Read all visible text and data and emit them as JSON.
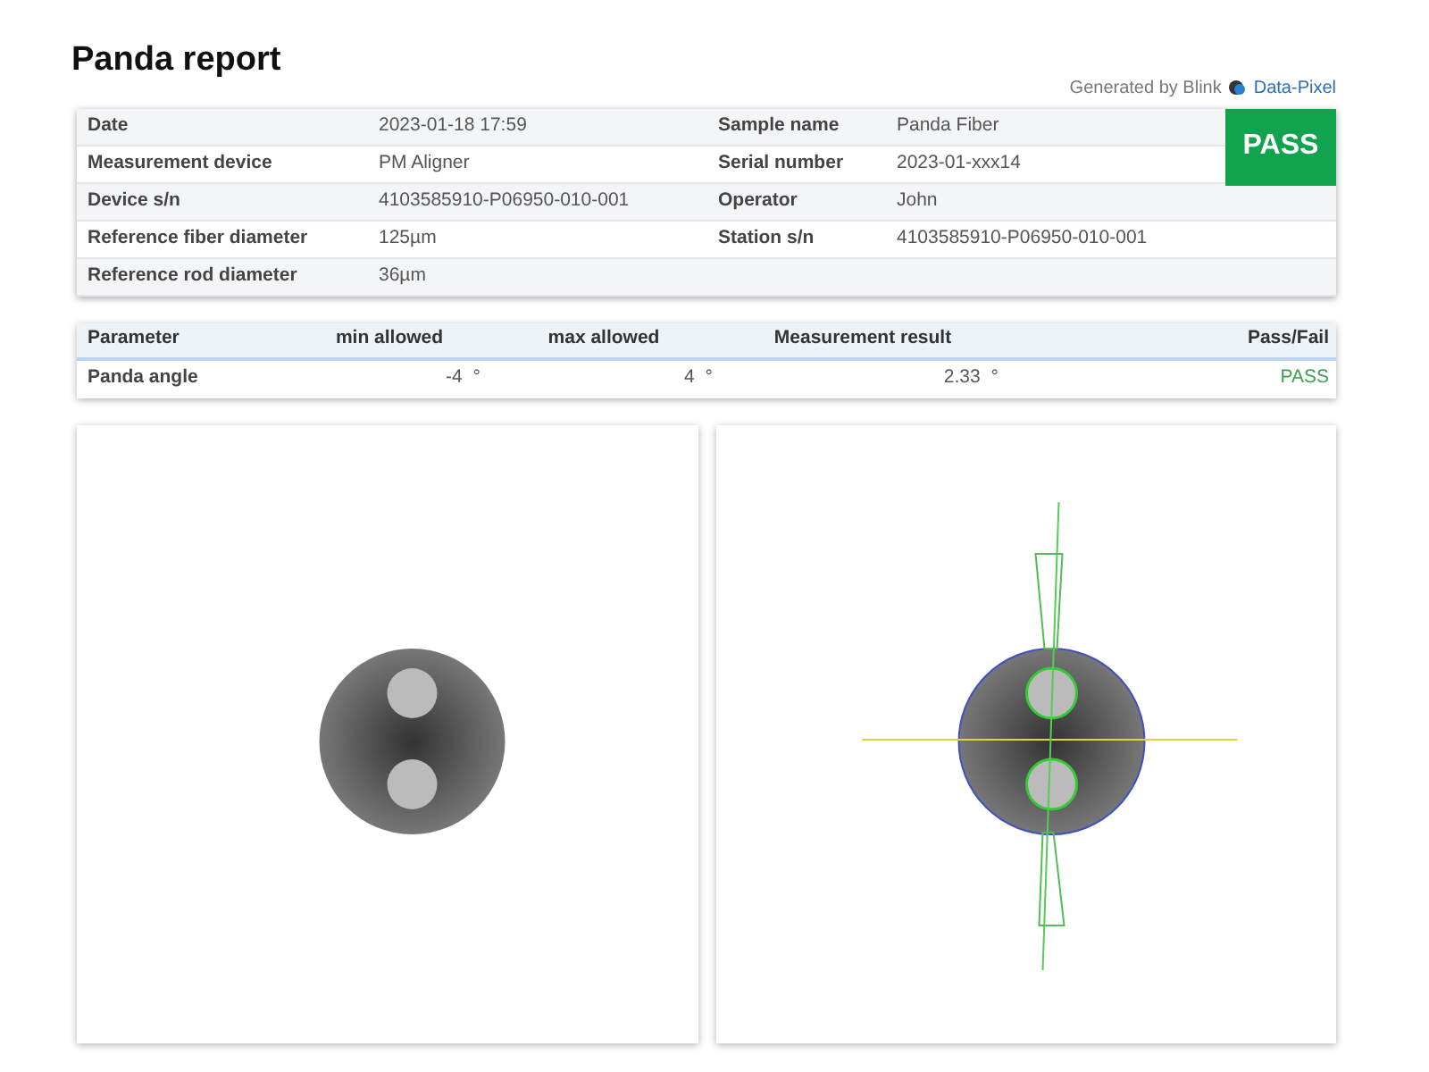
{
  "title": "Panda report",
  "generated_by": {
    "text": "Generated by Blink",
    "brand": "Data-Pixel"
  },
  "result_badge": {
    "text": "PASS",
    "passed": true
  },
  "info_rows": [
    {
      "label": "Date",
      "value": "2023-01-18 17:59",
      "label_2": "Sample name",
      "value_2": "Panda Fiber"
    },
    {
      "label": "Measurement device",
      "value": "PM Aligner",
      "label_2": "Serial number",
      "value_2": "2023-01-xxx14"
    },
    {
      "label": "Device s/n",
      "value": "4103585910-P06950-010-001",
      "label_2": "Operator",
      "value_2": "John"
    },
    {
      "label": "Reference fiber diameter",
      "value": "125µm",
      "label_2": "Station s/n",
      "value_2": "4103585910-P06950-010-001"
    },
    {
      "label": "Reference rod diameter",
      "value": "36µm"
    }
  ],
  "parameters": {
    "columns": [
      "Parameter",
      "min allowed",
      "max allowed",
      "Measurement result",
      "Pass/Fail"
    ],
    "rows": [
      {
        "name": "Panda angle",
        "min": "-4",
        "min_unit": "°",
        "max": "4",
        "max_unit": "°",
        "result": "2.33",
        "result_unit": "°",
        "pass_fail": "PASS",
        "passed": true
      }
    ]
  }
}
